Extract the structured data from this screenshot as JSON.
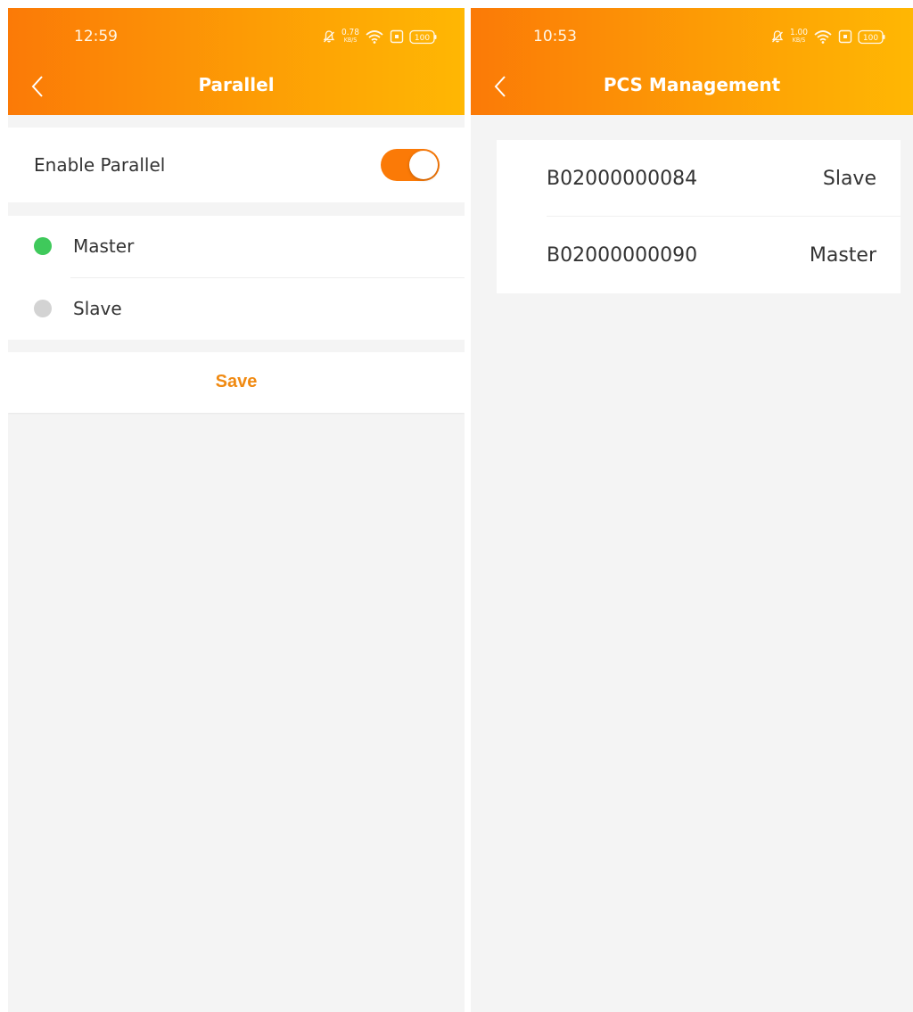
{
  "parallel_screen": {
    "status_bar": {
      "time": "12:59",
      "net_speed": "0.78",
      "net_unit": "KB/S",
      "battery": "100"
    },
    "title": "Parallel",
    "enable_parallel": {
      "label": "Enable Parallel",
      "enabled": true
    },
    "roles": [
      {
        "label": "Master",
        "selected": true
      },
      {
        "label": "Slave",
        "selected": false
      }
    ],
    "save_label": "Save"
  },
  "pcs_screen": {
    "status_bar": {
      "time": "10:53",
      "net_speed": "1.00",
      "net_unit": "KB/S",
      "battery": "100"
    },
    "title": "PCS Management",
    "devices": [
      {
        "id": "B02000000084",
        "role": "Slave"
      },
      {
        "id": "B02000000090",
        "role": "Master"
      }
    ]
  },
  "colors": {
    "header_start": "#fb7a07",
    "header_end": "#ffb703",
    "toggle_on": "#fb7a07",
    "radio_selected": "#3fc95b",
    "radio_unselected": "#d3d3d3",
    "save_text": "#f08a12",
    "background": "#f4f4f4"
  }
}
